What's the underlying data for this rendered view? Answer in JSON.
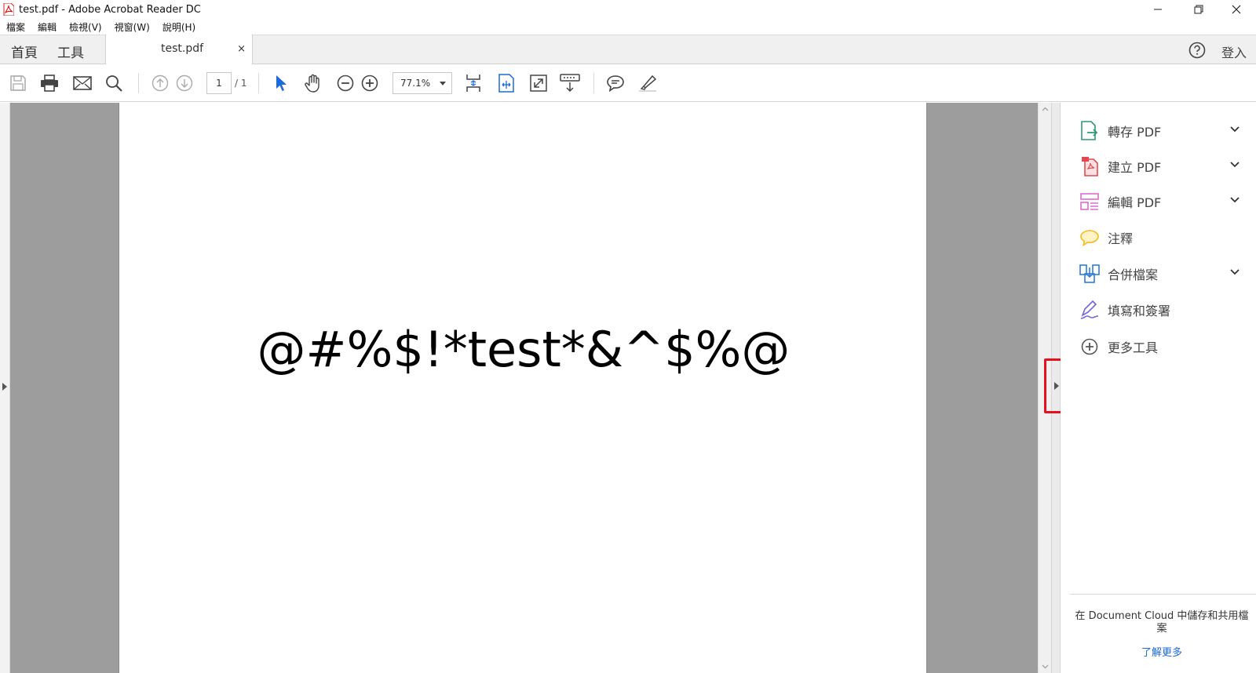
{
  "window": {
    "title": "test.pdf - Adobe Acrobat Reader DC"
  },
  "menu": [
    "檔案",
    "編輯",
    "檢視(V)",
    "視窗(W)",
    "說明(H)"
  ],
  "tabs": {
    "home": "首頁",
    "tools": "工具",
    "document": "test.pdf",
    "close": "×"
  },
  "header": {
    "sign_in": "登入"
  },
  "toolbar": {
    "page_current": "1",
    "page_total": "/ 1",
    "zoom": "77.1%"
  },
  "document": {
    "text": "@#%$!*test*&^$%@"
  },
  "tools_pane": {
    "items": [
      {
        "label": "轉存 PDF",
        "icon": "export-pdf-icon",
        "expandable": true,
        "color": "#2c9a7a"
      },
      {
        "label": "建立 PDF",
        "icon": "create-pdf-icon",
        "expandable": true,
        "color": "#e34850"
      },
      {
        "label": "編輯 PDF",
        "icon": "edit-pdf-icon",
        "expandable": true,
        "color": "#e06bd0"
      },
      {
        "label": "注釋",
        "icon": "comment-icon",
        "expandable": false,
        "color": "#f5b921"
      },
      {
        "label": "合併檔案",
        "icon": "combine-files-icon",
        "expandable": true,
        "color": "#2d7ed6"
      },
      {
        "label": "填寫和簽署",
        "icon": "fill-sign-icon",
        "expandable": false,
        "color": "#7a63d9"
      },
      {
        "label": "更多工具",
        "icon": "more-tools-icon",
        "expandable": false,
        "color": "#555555"
      }
    ],
    "cloud_message": "在 Document Cloud 中儲存和共用檔案",
    "learn_more": "了解更多"
  },
  "colors": {
    "accent_blue": "#1a6ad8",
    "highlight_red": "#e8101c",
    "viewer_gray": "#9d9d9d"
  }
}
